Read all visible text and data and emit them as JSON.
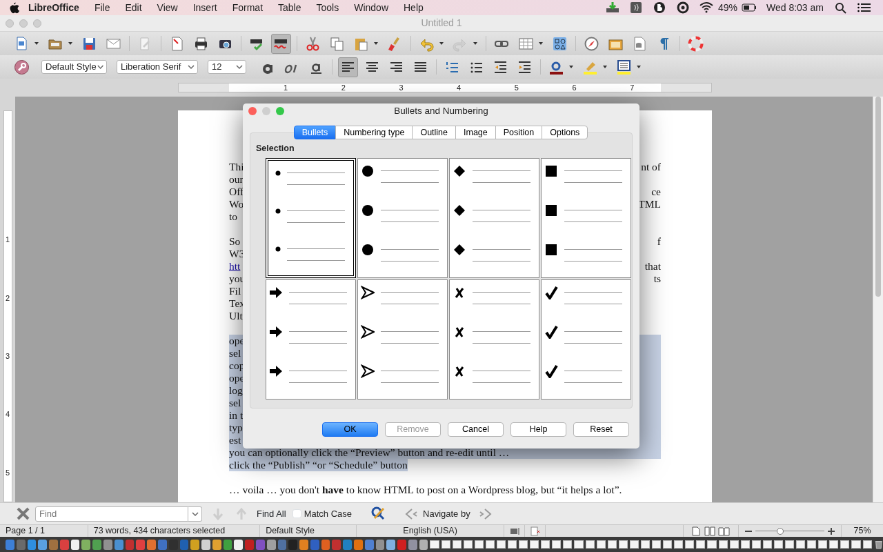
{
  "menubar": {
    "app_name": "LibreOffice",
    "menus": [
      "File",
      "Edit",
      "View",
      "Insert",
      "Format",
      "Table",
      "Tools",
      "Window",
      "Help"
    ],
    "battery": "49%",
    "clock": "Wed 8:03 am"
  },
  "window": {
    "title": "Untitled 1"
  },
  "standard_toolbar": {
    "autospell": {
      "on": true
    },
    "redo": {
      "disabled": true
    }
  },
  "formatting_toolbar": {
    "paragraph_style": "Default Style",
    "font_name": "Liberation Serif",
    "font_size": "12",
    "alignment": [
      {
        "selected": true
      },
      {
        "selected": false
      },
      {
        "selected": false
      },
      {
        "selected": false
      }
    ]
  },
  "ruler": {
    "horizontal_numbers": [
      "1",
      "2",
      "3",
      "4",
      "5",
      "6",
      "7"
    ],
    "vertical_numbers": [
      "1",
      "2",
      "3",
      "4",
      "5"
    ]
  },
  "document": {
    "paragraphs": [
      {
        "selected": false,
        "lines": [
          {
            "kind": "fragments",
            "left": "Thi",
            "right": "nt of"
          },
          {
            "kind": "fragments",
            "left": "our"
          },
          {
            "kind": "fragments",
            "left": "Off",
            "right": "ce"
          },
          {
            "kind": "fragments",
            "left": "Wo",
            "right": "TML"
          },
          {
            "kind": "fragments",
            "left": "to"
          }
        ]
      },
      {
        "selected": false,
        "lines": [
          {
            "kind": "fragments",
            "left": "So",
            "right": "f"
          },
          {
            "kind": "fragments",
            "left": "W3"
          },
          {
            "kind": "fragments",
            "left": "htt",
            "right": "that",
            "link": true
          },
          {
            "kind": "fragments",
            "left": "you",
            "right": "ts"
          },
          {
            "kind": "fragments",
            "left": "Fil"
          },
          {
            "kind": "fragments",
            "left": "Tex"
          },
          {
            "kind": "fragments",
            "left": "Ult"
          }
        ]
      },
      {
        "selected": true,
        "lines": [
          {
            "kind": "fragments",
            "left": "ope"
          },
          {
            "kind": "fragments",
            "left": "sel"
          },
          {
            "kind": "fragments",
            "left": "cop"
          },
          {
            "kind": "fragments",
            "left": "ope"
          },
          {
            "kind": "fragments",
            "left": "log"
          },
          {
            "kind": "fragments",
            "left": "sel"
          },
          {
            "kind": "fragments",
            "left": "in t"
          },
          {
            "kind": "fragments",
            "left": "typ"
          },
          {
            "kind": "fragments",
            "left": "est"
          },
          {
            "kind": "full",
            "text": "you can optionally click the “Preview” button and re-edit until …"
          },
          {
            "kind": "full",
            "text": "click the “Publish” “or “Schedule” button"
          }
        ]
      },
      {
        "selected": false,
        "lines": [
          {
            "kind": "full",
            "text": "… voila …  you don't **have** to know HTML to post on a Wordpress blog, but “it helps a lot”."
          }
        ]
      }
    ]
  },
  "dialog": {
    "title": "Bullets and Numbering",
    "tabs": [
      {
        "label": "Bullets",
        "selected": true
      },
      {
        "label": "Numbering type",
        "selected": false
      },
      {
        "label": "Outline",
        "selected": false
      },
      {
        "label": "Image",
        "selected": false
      },
      {
        "label": "Position",
        "selected": false
      },
      {
        "label": "Options",
        "selected": false
      }
    ],
    "section_label": "Selection",
    "presets": [
      {
        "kind": "small-dot",
        "selected": true
      },
      {
        "kind": "large-dot",
        "selected": false
      },
      {
        "kind": "diamond",
        "selected": false
      },
      {
        "kind": "square",
        "selected": false
      },
      {
        "kind": "arrow",
        "selected": false
      },
      {
        "kind": "arrowhead",
        "selected": false
      },
      {
        "kind": "cross",
        "selected": false
      },
      {
        "kind": "check",
        "selected": false
      }
    ],
    "buttons": [
      {
        "label": "OK",
        "default": true,
        "disabled": false
      },
      {
        "label": "Remove",
        "default": false,
        "disabled": true
      },
      {
        "label": "Cancel",
        "default": false,
        "disabled": false
      },
      {
        "label": "Help",
        "default": false,
        "disabled": false
      },
      {
        "label": "Reset",
        "default": false,
        "disabled": false
      }
    ]
  },
  "find_toolbar": {
    "placeholder": "Find",
    "find_all": "Find All",
    "match_case": {
      "label": "Match Case",
      "checked": false
    },
    "navigate_by": "Navigate by"
  },
  "status_bar": {
    "page": "Page 1 / 1",
    "word_count": "73 words, 434 characters selected",
    "page_style": "Default Style",
    "language": "English (USA)",
    "zoom": {
      "level": 0.36,
      "reading": "75%"
    }
  }
}
